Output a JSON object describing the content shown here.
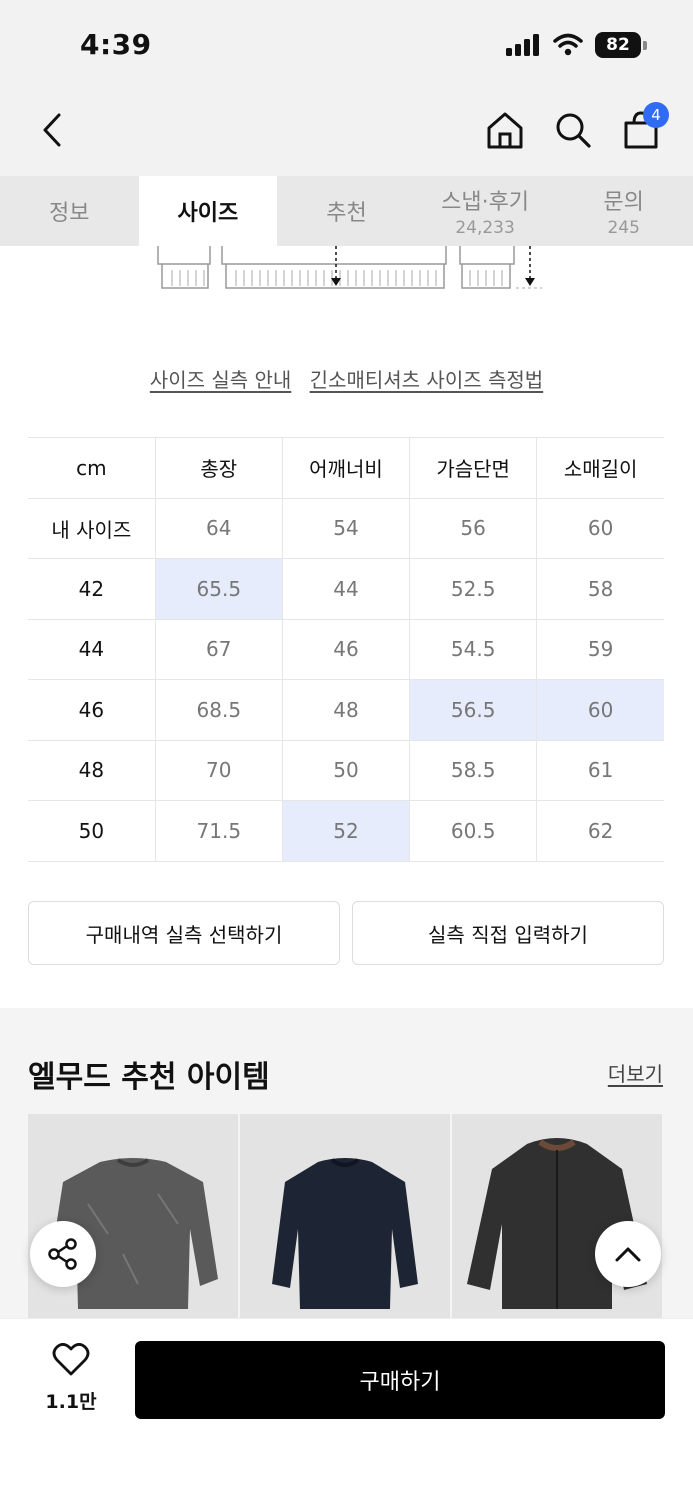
{
  "status_bar": {
    "time": "4:39",
    "battery": "82"
  },
  "header": {
    "cart_count": "4"
  },
  "tabs": [
    {
      "label": "정보",
      "count": ""
    },
    {
      "label": "사이즈",
      "count": ""
    },
    {
      "label": "추천",
      "count": ""
    },
    {
      "label": "스냅·후기",
      "count": "24,233"
    },
    {
      "label": "문의",
      "count": "245"
    }
  ],
  "links": {
    "size_guide": "사이즈 실측 안내",
    "measure_method": "긴소매티셔츠 사이즈 측정법"
  },
  "size_table": {
    "headers": [
      "cm",
      "총장",
      "어깨너비",
      "가슴단면",
      "소매길이"
    ],
    "rows": [
      {
        "label": "내 사이즈",
        "values": [
          "64",
          "54",
          "56",
          "60"
        ]
      },
      {
        "label": "42",
        "values": [
          "65.5",
          "44",
          "52.5",
          "58"
        ]
      },
      {
        "label": "44",
        "values": [
          "67",
          "46",
          "54.5",
          "59"
        ]
      },
      {
        "label": "46",
        "values": [
          "68.5",
          "48",
          "56.5",
          "60"
        ]
      },
      {
        "label": "48",
        "values": [
          "70",
          "50",
          "58.5",
          "61"
        ]
      },
      {
        "label": "50",
        "values": [
          "71.5",
          "52",
          "60.5",
          "62"
        ]
      }
    ],
    "highlight_color": "#e6ecfc"
  },
  "actions": {
    "select_history": "구매내역 실측 선택하기",
    "manual_input": "실측 직접 입력하기"
  },
  "recommendations": {
    "title": "엘무드 추천 아이템",
    "more": "더보기"
  },
  "bottom": {
    "like_count": "1.1만",
    "buy_label": "구매하기"
  },
  "colors": {
    "accent": "#2f6bf3",
    "buy_button": "#000000"
  }
}
